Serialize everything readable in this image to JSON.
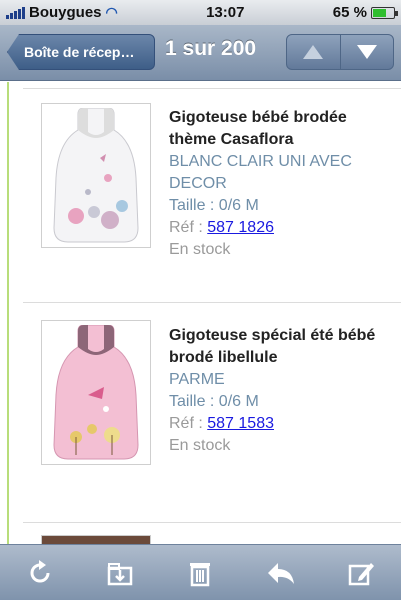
{
  "status": {
    "carrier": "Bouygues",
    "time": "13:07",
    "battery": "65 %",
    "battery_level": 0.65
  },
  "nav": {
    "back_label": "Boîte de récep…",
    "counter": "1 sur 200",
    "up_icon": "triangle-up-icon",
    "down_icon": "triangle-down-icon"
  },
  "products": [
    {
      "title_line1": "Gigoteuse bébé brodée",
      "title_line2": "thème Casaflora",
      "color_line1": "BLANC CLAIR UNI AVEC",
      "color_line2": "DECOR",
      "size": "Taille : 0/6 M",
      "ref_label": "Réf :",
      "ref_value": "587 1826",
      "stock": "En stock"
    },
    {
      "title_line1": "Gigoteuse spécial été bébé",
      "title_line2": "brodé libellule",
      "color_line1": "PARME",
      "size": "Taille : 0/6 M",
      "ref_label": "Réf :",
      "ref_value": "587 1583",
      "stock": "En stock"
    }
  ],
  "toolbar": {
    "icons": [
      "refresh-icon",
      "move-to-folder-icon",
      "trash-icon",
      "reply-icon",
      "compose-icon"
    ]
  },
  "colors": {
    "accent": "#6f8ea8",
    "link": "#1a1ae0",
    "rule": "#b8dd7a",
    "sleepsack_white": "#f4f4f6",
    "sleepsack_pink": "#f3bfd3"
  }
}
